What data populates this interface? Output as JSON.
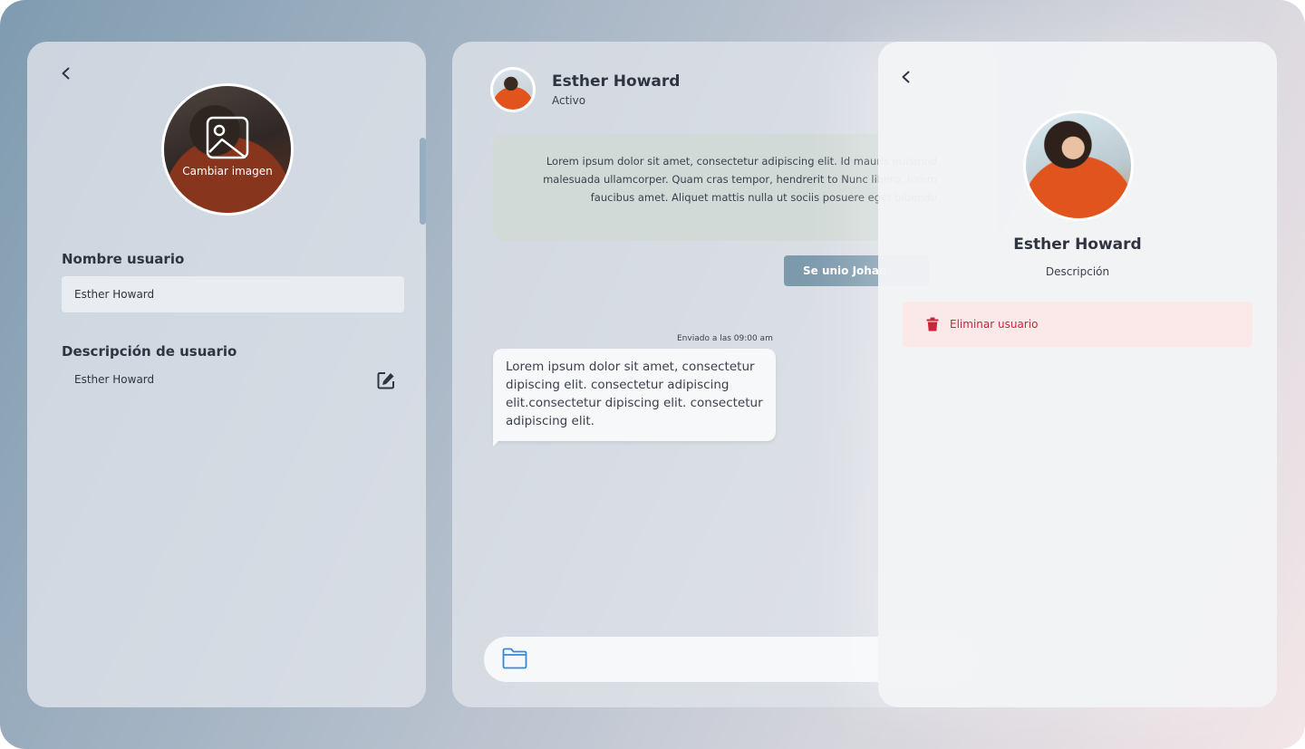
{
  "left_panel": {
    "avatar_action": "Cambiar imagen",
    "username_label": "Nombre usuario",
    "username_value": "Esther Howard",
    "description_label": "Descripción de usuario",
    "description_value": "Esther Howard"
  },
  "chat": {
    "contact_name": "Esther Howard",
    "contact_status": "Activo",
    "info_text": "Lorem ipsum dolor sit amet, consectetur adipiscing elit. Id mauris euismod malesuada ullamcorper. Quam cras tempor, hendrerit to Nunc libero, lorem faucibus amet. Aliquet mattis nulla ut sociis posuere eget bibendu",
    "join_button": "Se unio Johan",
    "message_time": "Enviado a las 09:00 am",
    "message_text": "Lorem ipsum dolor sit amet, consectetur dipiscing elit. consectetur adipiscing elit.consectetur dipiscing elit. consectetur adipiscing elit."
  },
  "profile_drawer": {
    "name": "Esther Howard",
    "description": "Descripción",
    "delete_label": "Eliminar usuario"
  },
  "icons": {
    "back": "chevron-left-icon",
    "change_image": "image-icon",
    "edit": "edit-icon",
    "attach": "folder-icon",
    "delete": "trash-icon"
  },
  "colors": {
    "accent_button": "#7d9aad",
    "delete_text": "#c8253b",
    "delete_bg": "#fbe9ea",
    "info_card_bg": "#d2dad8",
    "folder_icon": "#3a86d8"
  }
}
